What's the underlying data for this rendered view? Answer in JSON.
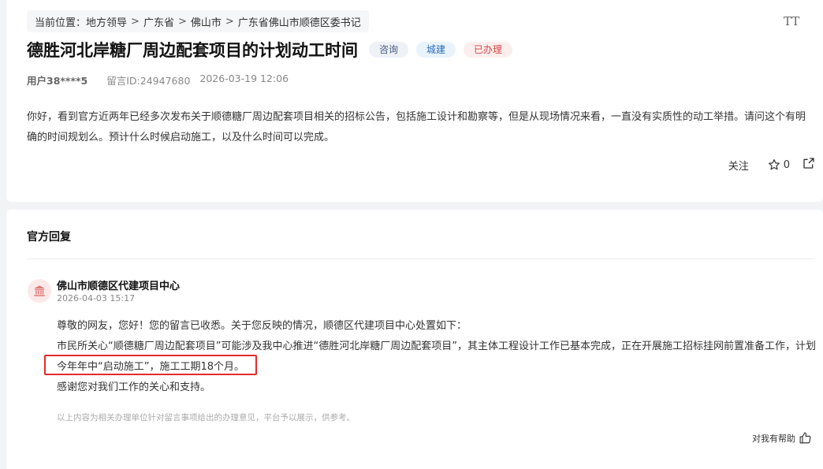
{
  "breadcrumb": {
    "prefix": "当前位置：",
    "items": [
      "地方领导",
      "广东省",
      "佛山市",
      "广东省佛山市顺德区委书记"
    ],
    "separator": ">"
  },
  "font_size_icon": "TT",
  "message": {
    "title": "德胜河北岸糖厂周边配套项目的计划动工时间",
    "tags": [
      "咨询",
      "城建",
      "已办理"
    ],
    "user": "用户38****5",
    "message_id": "留言ID:24947680",
    "datetime": "2026-03-19 12:06",
    "content": "你好，看到官方近两年已经多次发布关于顺德糖厂周边配套项目相关的招标公告，包括施工设计和勘察等，但是从现场情况来看，一直没有实质性的动工举措。请问这个有明确的时间规划么。预计什么时候启动施工，以及什么时间可以完成。",
    "follow_label": "关注",
    "star_count": "0"
  },
  "official": {
    "section_title": "官方回复",
    "org_name": "佛山市顺德区代建项目中心",
    "reply_time": "2026-04-03 15:17",
    "lines": [
      "尊敬的网友，您好！您的留言已收悉。关于您反映的情况，顺德区代建项目中心处置如下：",
      "市民所关心“顺德糖厂周边配套项目”可能涉及我中心推进“德胜河北岸糖厂周边配套项目”，其主体工程设计工作已基本完成，正在开展施工招标挂网前置准备工作，计划今年年中“启动施工”，施工工期18个月。",
      "感谢您对我们工作的关心和支持。"
    ],
    "disclaimer": "以上内容为相关办理单位针对留言事项给出的办理意见，平台予以展示，供参考。",
    "helpful_label": "对我有帮助"
  },
  "colors": {
    "highlight": "#e22b2b",
    "tag_done": "#d64545",
    "tag_city": "#2d6fb5"
  }
}
